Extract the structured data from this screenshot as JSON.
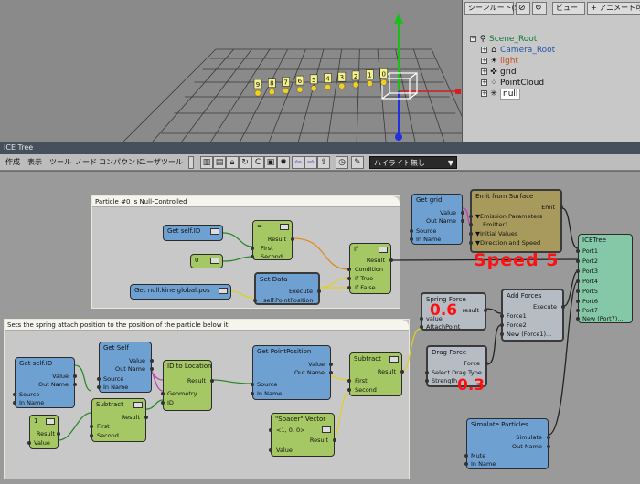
{
  "viewport": {
    "particle_labels": [
      "9",
      "8",
      "7",
      "6",
      "5",
      "4",
      "3",
      "2",
      "1",
      "0"
    ]
  },
  "explorer": {
    "toolbar": {
      "scene_root_btn": "シーンルート(S)",
      "view_btn": "ビュー",
      "animatable_btn": "+ アニメート可能なパラ"
    },
    "tree": [
      {
        "label": "Scene_Root",
        "icon": "scene-root-icon",
        "color": "#117a3a"
      },
      {
        "label": "Camera_Root",
        "icon": "camera-icon",
        "color": "#2255aa"
      },
      {
        "label": "light",
        "icon": "light-icon",
        "color": "#c84b1a"
      },
      {
        "label": "grid",
        "icon": "grid-icon",
        "color": "#111111"
      },
      {
        "label": "PointCloud",
        "icon": "pointcloud-icon",
        "color": "#111111"
      },
      {
        "label": "null",
        "icon": "null-icon",
        "color": "#111111"
      }
    ]
  },
  "ice": {
    "window_title": "ICE Tree",
    "menu": [
      "作成",
      "表示",
      "ツール",
      "ノード",
      "コンパウンド",
      "ユーザツール"
    ],
    "highlight_dropdown": "ハイライト無し",
    "comments": {
      "top": "Particle #0 is Null-Controlled",
      "bottom": "Sets the spring attach position to the position of the particle below it"
    },
    "nodes": {
      "get_self_id_top": {
        "title": "Get self.ID"
      },
      "equals": {
        "title": "=",
        "out": "Result",
        "in1": "First",
        "in2": "Second"
      },
      "zero_const": {
        "title": "0"
      },
      "get_null_pos": {
        "title": "Get null.kine.global.pos"
      },
      "set_data": {
        "title": "Set Data",
        "out": "Execute",
        "in1": "self.PointPosition"
      },
      "if_node": {
        "title": "If",
        "out": "Result",
        "in1": "Condition",
        "in2": "If True",
        "in3": "If False"
      },
      "get_grid": {
        "title": "Get grid",
        "out1": "Value",
        "out2": "Out Name",
        "in1": "Source",
        "in2": "In Name"
      },
      "emit_surface": {
        "title": "Emit from Surface",
        "out": "Emit",
        "p1": "Emission Parameters",
        "p2": "Emitter1",
        "p3": "Initial Values",
        "p4": "Direction and Speed"
      },
      "icetree": {
        "title": "ICETree",
        "ports": [
          "Port1",
          "Port2",
          "Port3",
          "Port4",
          "Port5",
          "Port6",
          "Port7",
          "New (Port7)..."
        ]
      },
      "spring_force": {
        "title": "Spring Force",
        "out": "result",
        "in1": "value",
        "in2": "AttachPoint"
      },
      "add_forces": {
        "title": "Add Forces",
        "out": "Execute",
        "in1": "Force1",
        "in2": "Force2",
        "in3": "New (Force1)..."
      },
      "drag_force": {
        "title": "Drag Force",
        "out": "Force",
        "in1": "Select Drag Type",
        "in2": "Strength"
      },
      "get_self_id_bot": {
        "title": "Get self.ID",
        "out1": "Value",
        "out2": "Out Name",
        "in1": "Source",
        "in2": "In Name"
      },
      "get_self": {
        "title": "Get Self",
        "out1": "Value",
        "out2": "Out Name",
        "in1": "Source",
        "in2": "In Name"
      },
      "id_to_location": {
        "title": "ID to Location",
        "out": "Result",
        "in1": "Geometry",
        "in2": "ID"
      },
      "get_point_position": {
        "title": "Get PointPosition",
        "out1": "Value",
        "out2": "Out Name",
        "in1": "Source",
        "in2": "In Name"
      },
      "subtract_right": {
        "title": "Subtract",
        "out": "Result",
        "in1": "First",
        "in2": "Second"
      },
      "subtract_left": {
        "title": "Subtract",
        "out": "Result",
        "in1": "First",
        "in2": "Second"
      },
      "one_const": {
        "title": "1",
        "out": "Result",
        "in1": "Value"
      },
      "spacer_vector": {
        "title": "\"Spacer\" Vector",
        "value": "<1, 0, 0>",
        "out": "Result",
        "in1": "Value"
      },
      "simulate_particles": {
        "title": "Simulate Particles",
        "out1": "Simulate",
        "out2": "Out Name",
        "in1": "Mute",
        "in2": "In Name"
      }
    },
    "annotations": {
      "speed": "Speed 5",
      "spring_value": "0.6",
      "drag_value": "0.3"
    }
  }
}
